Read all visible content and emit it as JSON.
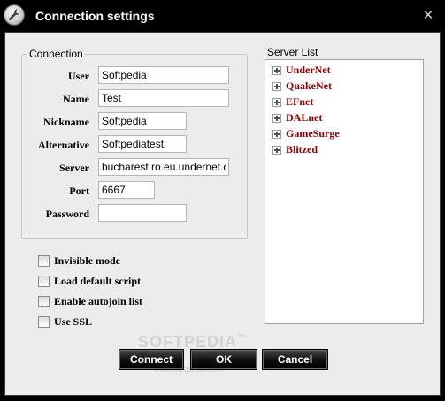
{
  "window": {
    "title": "Connection settings",
    "icon": "wrench-icon",
    "close_glyph": "✕"
  },
  "connection": {
    "legend": "Connection",
    "fields": [
      {
        "label": "User",
        "value": "Softpedia"
      },
      {
        "label": "Name",
        "value": "Test"
      },
      {
        "label": "Nickname",
        "value": "Softpedia"
      },
      {
        "label": "Alternative",
        "value": "Softpediatest"
      },
      {
        "label": "Server",
        "value": "bucharest.ro.eu.undernet.org"
      },
      {
        "label": "Port",
        "value": "6667"
      },
      {
        "label": "Password",
        "value": ""
      }
    ]
  },
  "options": [
    {
      "label": "Invisible mode",
      "checked": false
    },
    {
      "label": "Load default script",
      "checked": false
    },
    {
      "label": "Enable autojoin list",
      "checked": false
    },
    {
      "label": "Use SSL",
      "checked": false
    }
  ],
  "server_list": {
    "legend": "Server List",
    "items": [
      "UnderNet",
      "QuakeNet",
      "EFnet",
      "DALnet",
      "GameSurge",
      "Blitzed"
    ]
  },
  "buttons": {
    "connect": "Connect",
    "ok": "OK",
    "cancel": "Cancel"
  },
  "watermark": {
    "text": "SOFTPEDIA",
    "mark": "™",
    "sub": "www.softpedia.com"
  },
  "colors": {
    "tree_label": "#8b0000",
    "titlebar": "#000000",
    "client_bg": "#ececec"
  }
}
